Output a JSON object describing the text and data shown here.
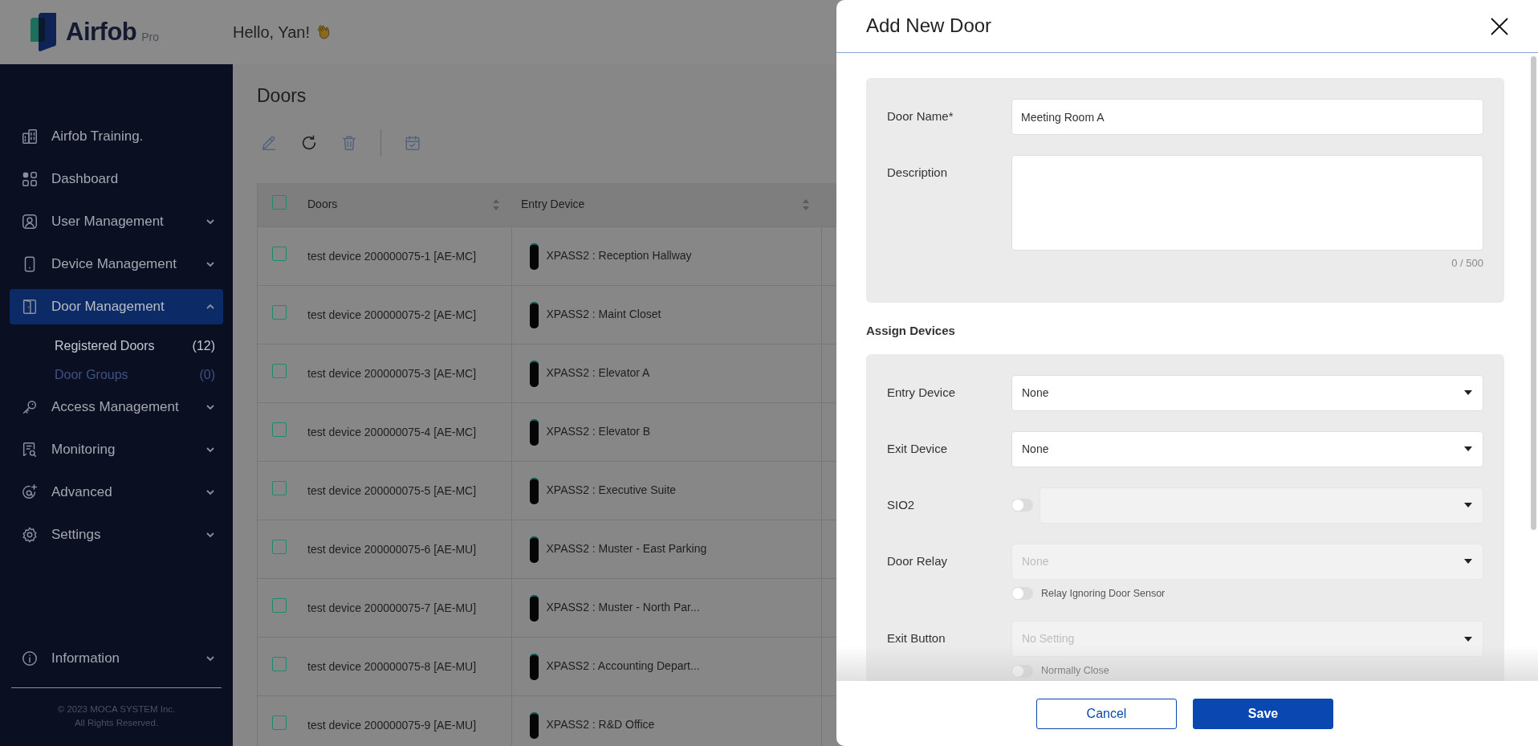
{
  "header": {
    "logo": "Airfob",
    "logo_badge": "Pro",
    "greeting": "Hello, Yan!"
  },
  "sidebar": {
    "items": [
      {
        "label": "Airfob Training.",
        "expandable": false,
        "selected": false
      },
      {
        "label": "Dashboard",
        "expandable": false,
        "selected": false
      },
      {
        "label": "User Management",
        "expandable": true,
        "expanded": false,
        "selected": false
      },
      {
        "label": "Device Management",
        "expandable": true,
        "expanded": false,
        "selected": false
      },
      {
        "label": "Door Management",
        "expandable": true,
        "expanded": true,
        "selected": true,
        "children": [
          {
            "label": "Registered Doors",
            "count": "(12)",
            "selected": true
          },
          {
            "label": "Door Groups",
            "count": "(0)",
            "selected": false
          }
        ]
      },
      {
        "label": "Access Management",
        "expandable": true,
        "expanded": false,
        "selected": false
      },
      {
        "label": "Monitoring",
        "expandable": true,
        "expanded": false,
        "selected": false
      },
      {
        "label": "Advanced",
        "expandable": true,
        "expanded": false,
        "selected": false
      },
      {
        "label": "Settings",
        "expandable": true,
        "expanded": false,
        "selected": false
      }
    ],
    "footer_item": {
      "label": "Information",
      "expandable": true,
      "expanded": false
    },
    "copyright": [
      "© 2023 MOCA SYSTEM Inc.",
      "All Rights Reserved."
    ]
  },
  "page": {
    "title": "Doors",
    "table": {
      "header_checked": false,
      "columns": [
        "Doors",
        "Entry Device"
      ],
      "rows": [
        {
          "checked": false,
          "door": "test device 200000075-1 [AE-MC]",
          "entry_device": "XPASS2 : Reception Hallway"
        },
        {
          "checked": false,
          "door": "test device 200000075-2 [AE-MC]",
          "entry_device": "XPASS2 : Maint Closet"
        },
        {
          "checked": false,
          "door": "test device 200000075-3 [AE-MC]",
          "entry_device": "XPASS2 : Elevator A"
        },
        {
          "checked": false,
          "door": "test device 200000075-4 [AE-MC]",
          "entry_device": "XPASS2 : Elevator B"
        },
        {
          "checked": false,
          "door": "test device 200000075-5 [AE-MC]",
          "entry_device": "XPASS2 : Executive Suite"
        },
        {
          "checked": false,
          "door": "test device 200000075-6 [AE-MU]",
          "entry_device": "XPASS2 : Muster - East Parking"
        },
        {
          "checked": false,
          "door": "test device 200000075-7 [AE-MU]",
          "entry_device": "XPASS2 : Muster - North Par..."
        },
        {
          "checked": false,
          "door": "test device 200000075-8 [AE-MU]",
          "entry_device": "XPASS2 : Accounting Depart..."
        },
        {
          "checked": false,
          "door": "test device 200000075-9 [AE-MU]",
          "entry_device": "XPASS2 : R&D Office"
        }
      ]
    }
  },
  "modal": {
    "title": "Add New Door",
    "sections": [
      {
        "fields": [
          {
            "kind": "text",
            "label": "Door Name*",
            "value": "Meeting Room A"
          },
          {
            "kind": "textarea",
            "label": "Description",
            "counter": "0 / 500"
          }
        ]
      },
      {
        "heading": "Assign Devices",
        "fields": [
          {
            "kind": "select",
            "label": "Entry Device",
            "value": "None",
            "disabled": false
          },
          {
            "kind": "select",
            "label": "Exit Device",
            "value": "None",
            "disabled": false
          },
          {
            "kind": "toggle-select",
            "label": "SIO2",
            "on": false,
            "disabled": true
          },
          {
            "kind": "select",
            "label": "Door Relay",
            "placeholder": "None",
            "disabled": true,
            "option": {
              "label": "Relay Ignoring Door Sensor",
              "on": false
            }
          },
          {
            "kind": "select",
            "label": "Exit Button",
            "placeholder": "No Setting",
            "disabled": true,
            "option": {
              "label": "Normally Close",
              "on": false
            }
          }
        ]
      }
    ],
    "buttons": [
      {
        "label": "Cancel",
        "kind": "secondary"
      },
      {
        "label": "Save",
        "kind": "primary"
      }
    ]
  }
}
